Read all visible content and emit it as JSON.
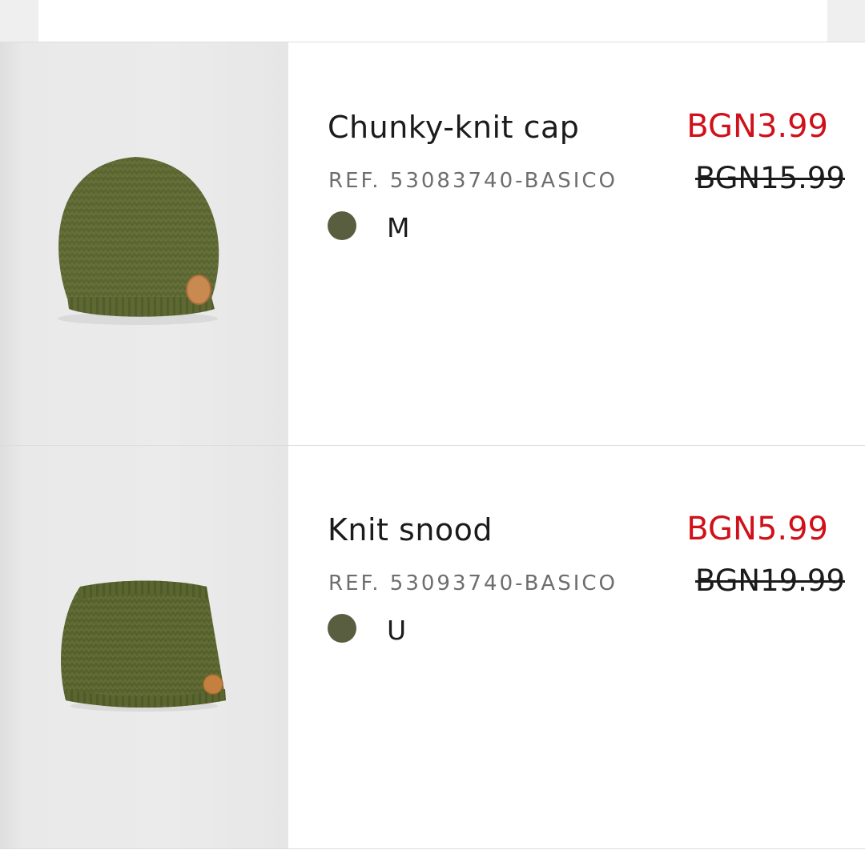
{
  "colors": {
    "sale_price": "#d0101a",
    "swatch_olive": "#5a5e41",
    "background": "#ffffff",
    "image_background": "#ebebeb"
  },
  "items": [
    {
      "name": "Chunky-knit cap",
      "reference": "REF. 53083740-BASICO",
      "color_swatch": "olive green",
      "size": "M",
      "price": "BGN3.99",
      "original_price": "BGN15.99",
      "image": "olive-knit-beanie"
    },
    {
      "name": "Knit snood",
      "reference": "REF. 53093740-BASICO",
      "color_swatch": "olive green",
      "size": "U",
      "price": "BGN5.99",
      "original_price": "BGN19.99",
      "image": "olive-knit-snood"
    }
  ]
}
